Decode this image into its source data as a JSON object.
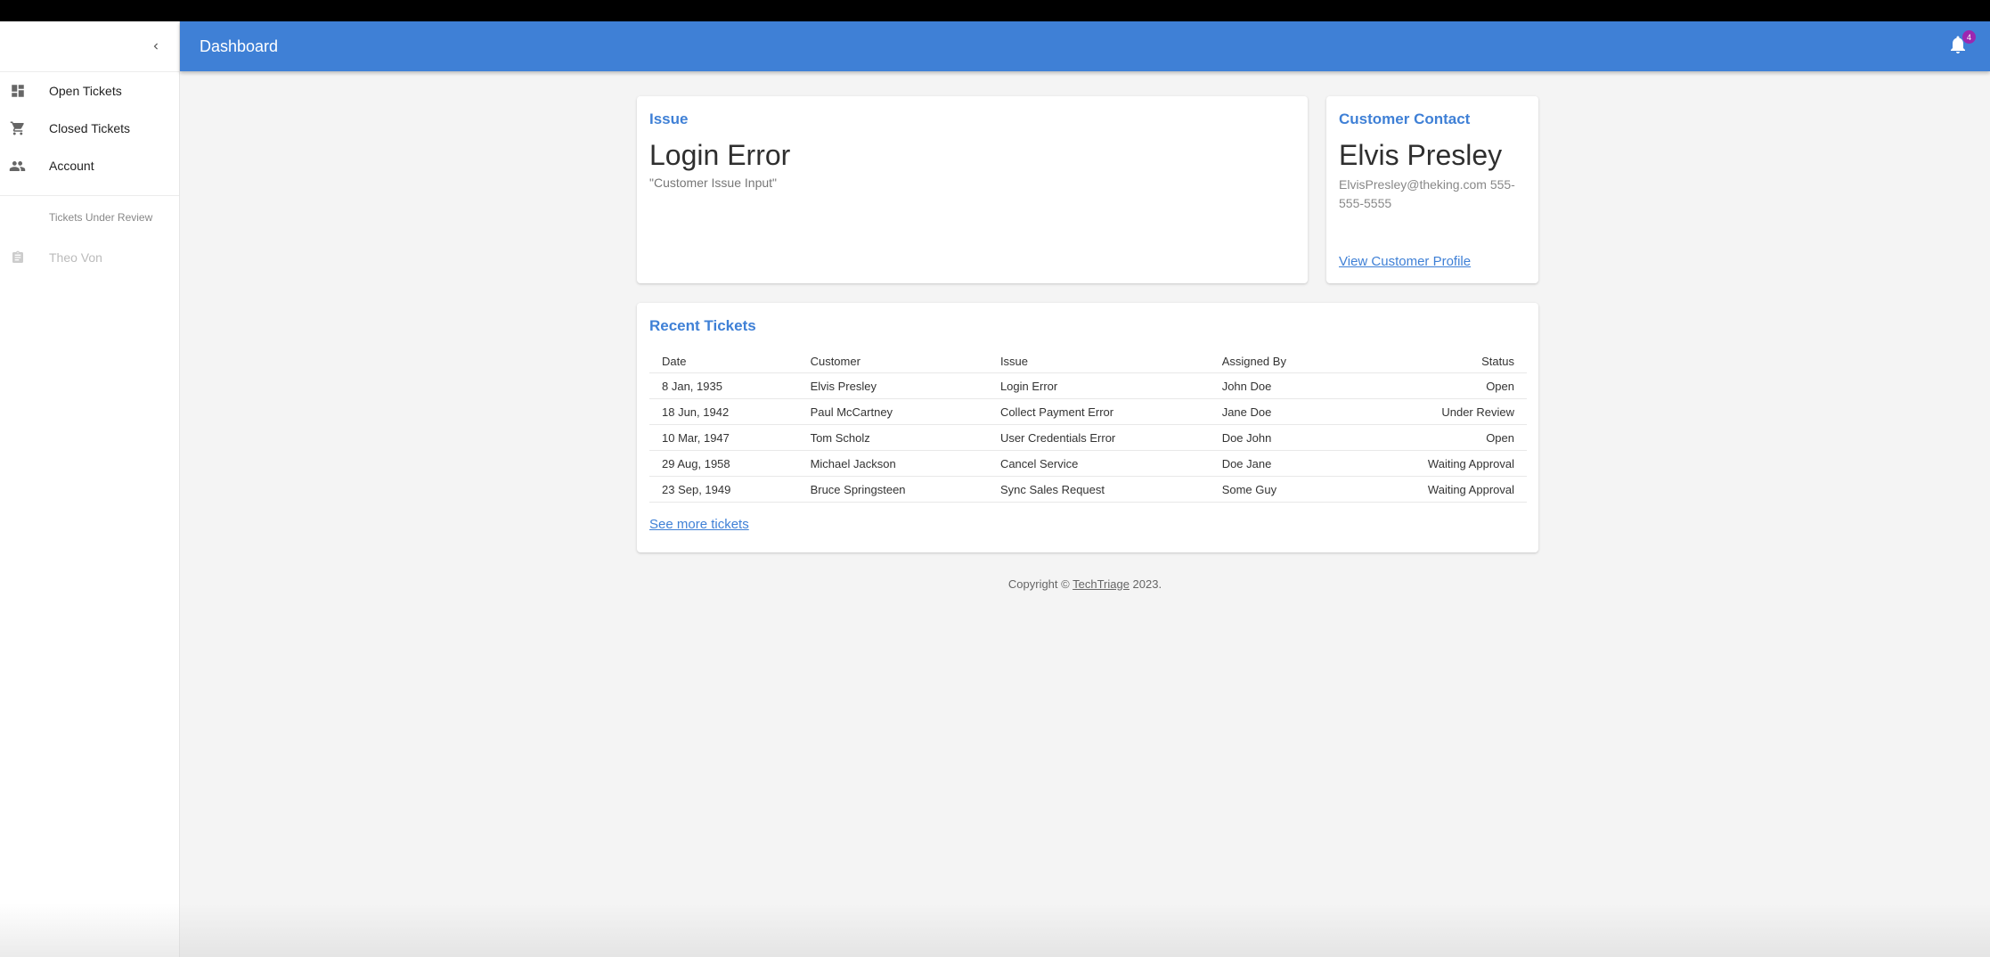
{
  "header": {
    "title": "Dashboard",
    "notification_count": "4"
  },
  "sidebar": {
    "items": [
      {
        "label": "Open Tickets",
        "icon": "dashboard-icon"
      },
      {
        "label": "Closed Tickets",
        "icon": "cart-icon"
      },
      {
        "label": "Account",
        "icon": "people-icon"
      }
    ],
    "subheader": "Tickets Under Review",
    "review_items": [
      {
        "label": "Theo Von",
        "icon": "assignment-icon"
      }
    ]
  },
  "issue": {
    "title": "Issue",
    "heading": "Login Error",
    "text": "\"Customer Issue Input\""
  },
  "contact": {
    "title": "Customer Contact",
    "name": "Elvis Presley",
    "info": "ElvisPresley@theking.com 555-555-5555",
    "link": "View Customer Profile"
  },
  "tickets": {
    "title": "Recent Tickets",
    "columns": [
      "Date",
      "Customer",
      "Issue",
      "Assigned By",
      "Status"
    ],
    "rows": [
      [
        "8 Jan, 1935",
        "Elvis Presley",
        "Login Error",
        "John Doe",
        "Open"
      ],
      [
        "18 Jun, 1942",
        "Paul McCartney",
        "Collect Payment Error",
        "Jane Doe",
        "Under Review"
      ],
      [
        "10 Mar, 1947",
        "Tom Scholz",
        "User Credentials Error",
        "Doe John",
        "Open"
      ],
      [
        "29 Aug, 1958",
        "Michael Jackson",
        "Cancel Service",
        "Doe Jane",
        "Waiting Approval"
      ],
      [
        "23 Sep, 1949",
        "Bruce Springsteen",
        "Sync Sales Request",
        "Some Guy",
        "Waiting Approval"
      ]
    ],
    "see_more": "See more tickets"
  },
  "footer": {
    "prefix": "Copyright © ",
    "brand": "TechTriage",
    "suffix": " 2023."
  },
  "colors": {
    "primary": "#3f80d6",
    "badge": "#9c27b0",
    "background": "#f4f4f4"
  }
}
